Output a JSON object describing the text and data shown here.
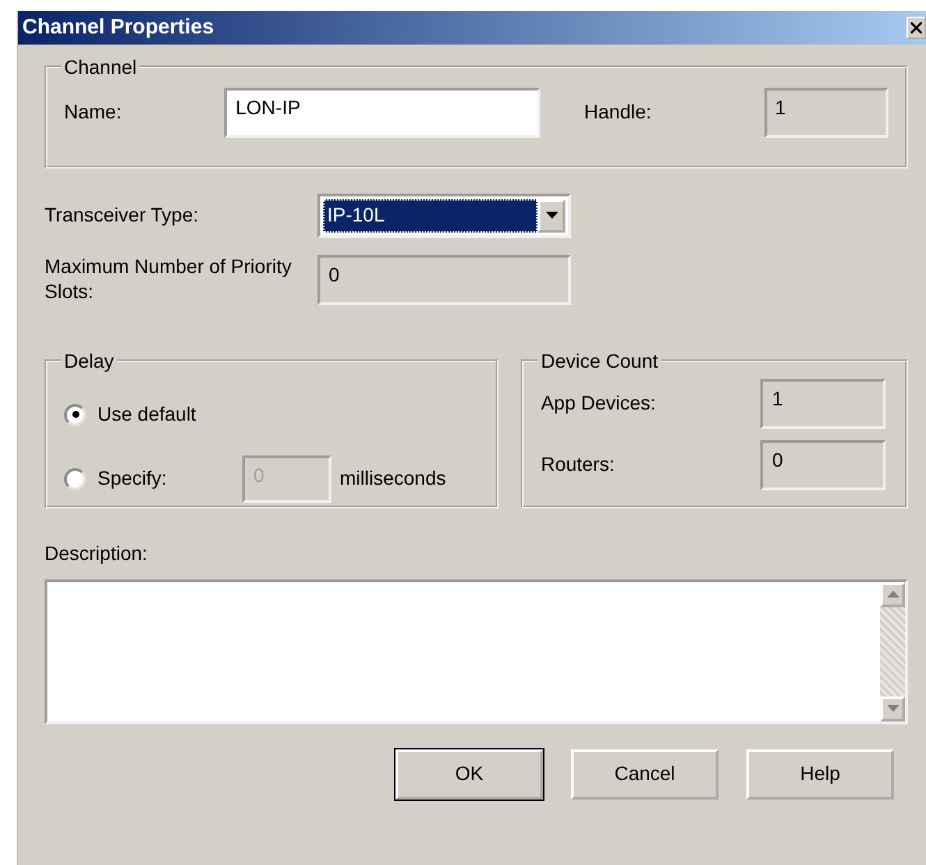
{
  "window": {
    "title": "Channel Properties"
  },
  "channel": {
    "legend": "Channel",
    "name_label": "Name:",
    "name_value": "LON-IP",
    "handle_label": "Handle:",
    "handle_value": "1"
  },
  "transceiver": {
    "label": "Transceiver Type:",
    "value": "IP-10L"
  },
  "priority": {
    "label": "Maximum  Number of Priority Slots:",
    "value": "0"
  },
  "delay": {
    "legend": "Delay",
    "options": [
      {
        "label": "Use default",
        "selected": true
      },
      {
        "label": "Specify:",
        "selected": false
      }
    ],
    "specify_value": "0",
    "specify_disabled": true,
    "unit": "milliseconds"
  },
  "device_count": {
    "legend": "Device Count",
    "rows": [
      {
        "label": "App Devices:",
        "value": "1"
      },
      {
        "label": "Routers:",
        "value": "0"
      }
    ]
  },
  "description": {
    "label": "Description:"
  },
  "buttons": [
    {
      "label": "OK",
      "default": true
    },
    {
      "label": "Cancel",
      "default": false
    },
    {
      "label": "Help",
      "default": false
    }
  ]
}
